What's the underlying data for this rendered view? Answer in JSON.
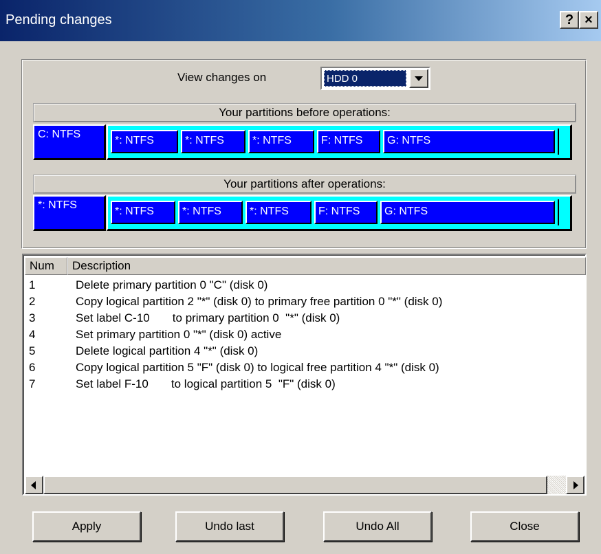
{
  "window": {
    "title": "Pending changes",
    "help_glyph": "?",
    "close_glyph": "×"
  },
  "view": {
    "label": "View changes on",
    "selected_disk": "HDD 0"
  },
  "before": {
    "header": "Your partitions before operations:",
    "primary": "C: NTFS",
    "logical": [
      "*: NTFS",
      "*: NTFS",
      "*: NTFS",
      "F: NTFS",
      "G: NTFS"
    ]
  },
  "after": {
    "header": "Your partitions after operations:",
    "primary": "*: NTFS",
    "logical": [
      "*: NTFS",
      "*: NTFS",
      "*: NTFS",
      "F: NTFS",
      "G: NTFS"
    ]
  },
  "list": {
    "columns": [
      "Num",
      "Description"
    ],
    "rows": [
      {
        "num": "1",
        "desc": "Delete primary partition 0  \"C\" (disk 0)"
      },
      {
        "num": "2",
        "desc": "Copy logical partition 2  \"*\" (disk 0)  to primary free partition 0  \"*\" (disk 0)"
      },
      {
        "num": "3",
        "desc": "Set label C-10       to primary partition 0  \"*\" (disk 0)"
      },
      {
        "num": "4",
        "desc": "Set primary partition 0  \"*\" (disk 0) active"
      },
      {
        "num": "5",
        "desc": "Delete logical partition 4  \"*\" (disk 0)"
      },
      {
        "num": "6",
        "desc": "Copy logical partition 5  \"F\" (disk 0)  to logical free partition 4  \"*\" (disk 0)"
      },
      {
        "num": "7",
        "desc": "Set label F-10       to logical partition 5  \"F\" (disk 0)"
      }
    ]
  },
  "buttons": {
    "apply": "Apply",
    "undo_last": "Undo last",
    "undo_all": "Undo All",
    "close": "Close"
  },
  "colors": {
    "partition_fill": "#0000ff",
    "extended_fill": "#00ffff",
    "dialog_face": "#d4d0c8",
    "selection": "#0a246a"
  }
}
